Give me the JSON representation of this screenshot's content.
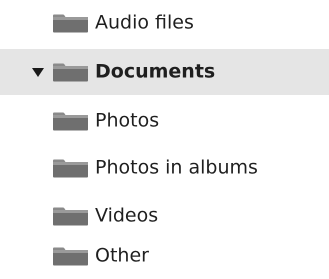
{
  "folder_tree": {
    "items": [
      {
        "label": "Audio files",
        "expanded": false,
        "selected": false,
        "has_arrow": false
      },
      {
        "label": "Documents",
        "expanded": true,
        "selected": true,
        "has_arrow": true
      },
      {
        "label": "Photos",
        "expanded": false,
        "selected": false,
        "has_arrow": false
      },
      {
        "label": "Photos in albums",
        "expanded": false,
        "selected": false,
        "has_arrow": false
      },
      {
        "label": "Videos",
        "expanded": false,
        "selected": false,
        "has_arrow": false
      },
      {
        "label": "Other",
        "expanded": false,
        "selected": false,
        "has_arrow": false
      }
    ]
  },
  "colors": {
    "selected_background": "#e5e5e5",
    "folder_body": "#6f6f6f",
    "folder_tab": "#8a8a8a",
    "text": "#1f1f1f"
  },
  "icons": {
    "folder": "folder-icon",
    "expand_arrow": "expanded-arrow-icon"
  }
}
